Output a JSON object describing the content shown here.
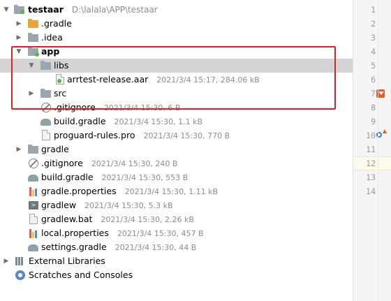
{
  "project_tree": {
    "root": {
      "name": "testaar",
      "path": "D:\\lalala\\APP\\testaar"
    },
    "gradle_dir": {
      "name": ".gradle"
    },
    "idea_dir": {
      "name": ".idea"
    },
    "app_module": {
      "name": "app",
      "libs": {
        "name": "libs",
        "aar": {
          "name": "arrtest-release.aar",
          "meta": "2021/3/4 15:17, 284.06 kB"
        }
      },
      "src": {
        "name": "src"
      },
      "gitignore": {
        "name": ".gitignore",
        "meta": "2021/3/4 15:30, 6 B"
      },
      "build_gradle": {
        "name": "build.gradle",
        "meta": "2021/3/4 15:30, 1.1 kB"
      },
      "proguard": {
        "name": "proguard-rules.pro",
        "meta": "2021/3/4 15:30, 770 B"
      }
    },
    "gradle_folder": {
      "name": "gradle"
    },
    "root_gitignore": {
      "name": ".gitignore",
      "meta": "2021/3/4 15:30, 240 B"
    },
    "root_build_gradle": {
      "name": "build.gradle",
      "meta": "2021/3/4 15:30, 553 B"
    },
    "gradle_properties": {
      "name": "gradle.properties",
      "meta": "2021/3/4 15:30, 1.11 kB"
    },
    "gradlew": {
      "name": "gradlew",
      "meta": "2021/3/4 15:30, 5.3 kB"
    },
    "gradlew_bat": {
      "name": "gradlew.bat",
      "meta": "2021/3/4 15:30, 2.26 kB"
    },
    "local_properties": {
      "name": "local.properties",
      "meta": "2021/3/4 15:30, 457 B"
    },
    "settings_gradle": {
      "name": "settings.gradle",
      "meta": "2021/3/4 15:30, 44 B"
    },
    "external_libraries": {
      "name": "External Libraries"
    },
    "scratches": {
      "name": "Scratches and Consoles"
    }
  },
  "editor_gutter": {
    "line_numbers": [
      "1",
      "2",
      "3",
      "4",
      "5",
      "6",
      "7",
      "8",
      "9",
      "10",
      "11",
      "12",
      "13",
      "14"
    ]
  },
  "colors": {
    "selection": "#d4d4d4",
    "highlight_box": "#e02020",
    "module_indicator": "#62b543",
    "folder_excluded": "#e8a33d"
  },
  "icons": {
    "module": "module-folder-icon",
    "folder": "folder-icon",
    "excluded_folder": "orange-folder-icon",
    "archive": "aar-file-icon",
    "gitignore": "gitignore-icon",
    "gradle": "gradle-elephant-icon",
    "properties": "properties-file-icon",
    "shell": "terminal-icon",
    "text": "text-file-icon",
    "libraries": "external-libraries-icon",
    "scratches": "scratches-icon"
  }
}
